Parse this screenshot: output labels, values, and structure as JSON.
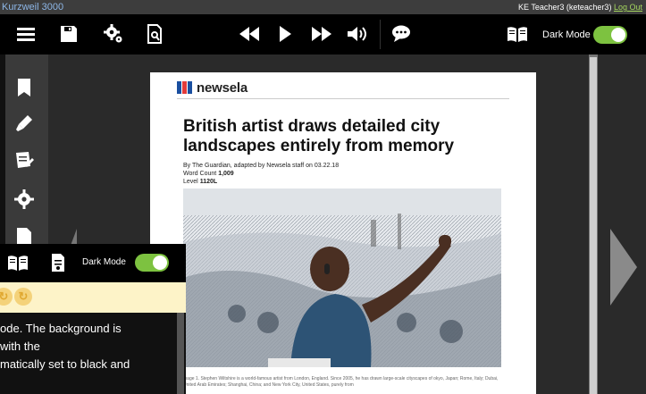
{
  "titlebar": {
    "app_name": "Kurzweil 3000",
    "user": "KE Teacher3 (keteacher3)",
    "logout": "Log Out"
  },
  "toolbar": {
    "items": [
      {
        "icon": "menu-icon"
      },
      {
        "icon": "save-icon"
      },
      {
        "icon": "settings-gear-icon"
      },
      {
        "icon": "document-search-icon"
      },
      {
        "icon": "rewind-icon"
      },
      {
        "icon": "play-icon"
      },
      {
        "icon": "fast-forward-icon"
      },
      {
        "icon": "volume-icon"
      },
      {
        "icon": "speech-bubble-icon"
      },
      {
        "icon": "book-icon"
      }
    ],
    "dark_mode_label": "Dark Mode",
    "dark_mode_on": true,
    "toggle_color": "#7dc240"
  },
  "sidebar": {
    "items": [
      {
        "icon": "bookmark-icon"
      },
      {
        "icon": "highlighter-icon"
      },
      {
        "icon": "notes-icon"
      },
      {
        "icon": "gear-icon"
      },
      {
        "icon": "page-icon"
      }
    ]
  },
  "document": {
    "logo_text": "newsela",
    "logo_colors": [
      "#1a4fa0",
      "#e23b3b",
      "#1a4fa0"
    ],
    "headline": "British artist draws detailed city landscapes entirely from memory",
    "byline": "By The Guardian, adapted by Newsela staff on 03.22.18",
    "word_count_label": "Word Count",
    "word_count": "1,009",
    "level_label": "Level",
    "level": "1120L",
    "caption": "mage 1. Stephen Wiltshire is a world-famous artist from London, England. Since 2005, he has drawn large-scale cityscapes of okyo, Japan; Rome, Italy; Dubai, United Arab Emirates; Shanghai, China; and New York City, United States, purely from"
  },
  "overlay": {
    "dark_mode_label": "Dark Mode",
    "text_lines": [
      "ode.  The background is",
      " with the",
      "matically set to black and"
    ]
  }
}
